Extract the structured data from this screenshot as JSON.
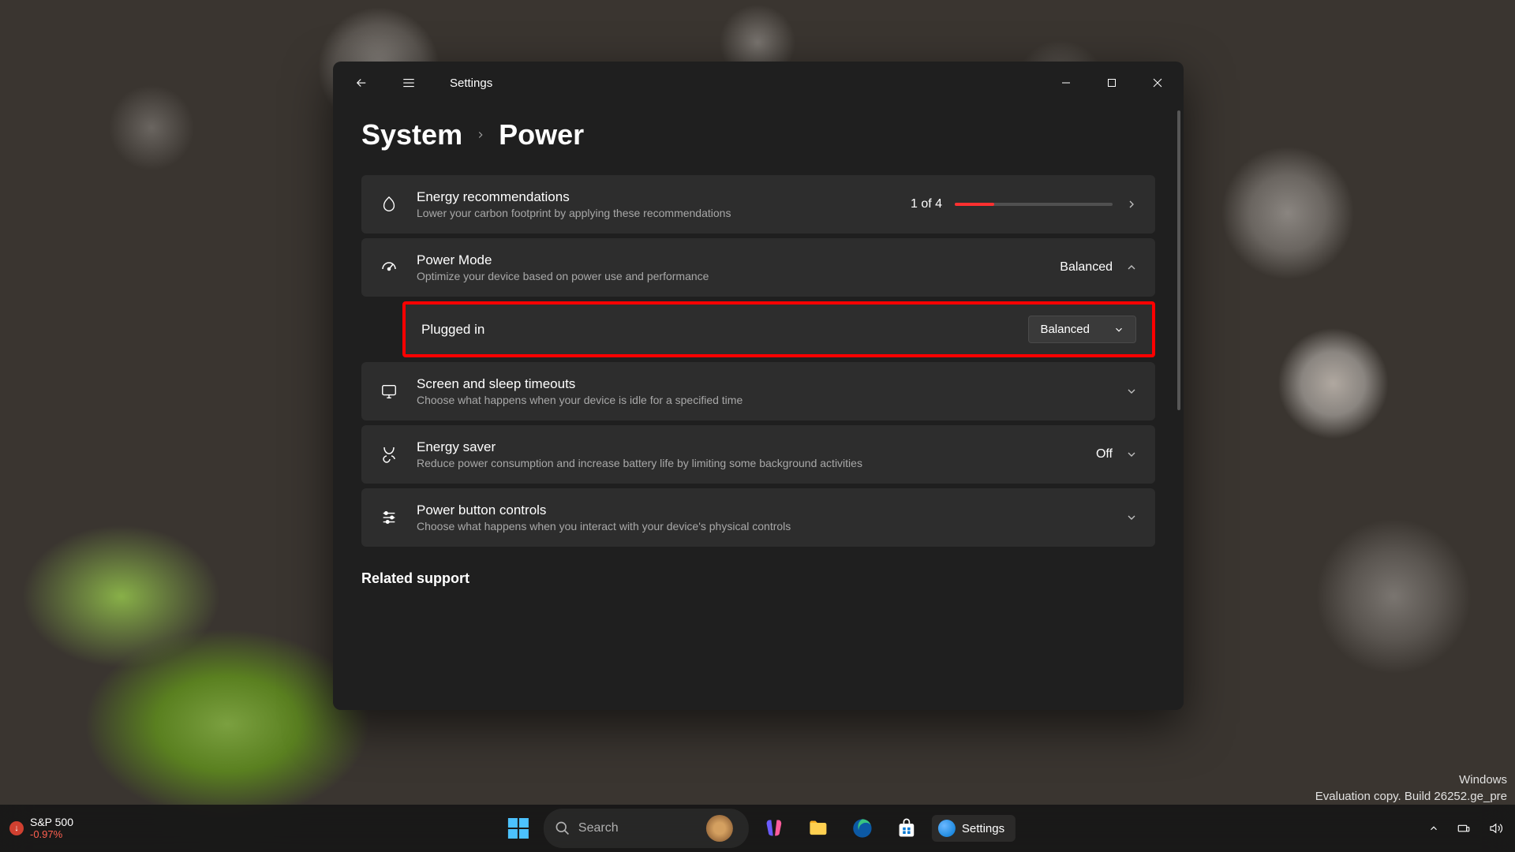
{
  "window": {
    "title": "Settings"
  },
  "breadcrumb": {
    "parent": "System",
    "current": "Power"
  },
  "cards": {
    "energy_rec": {
      "title": "Energy recommendations",
      "sub": "Lower your carbon footprint by applying these recommendations",
      "progress_text": "1 of 4",
      "progress_pct": 25
    },
    "power_mode": {
      "title": "Power Mode",
      "sub": "Optimize your device based on power use and performance",
      "value": "Balanced"
    },
    "plugged_in": {
      "label": "Plugged in",
      "selected": "Balanced"
    },
    "screen_sleep": {
      "title": "Screen and sleep timeouts",
      "sub": "Choose what happens when your device is idle for a specified time"
    },
    "energy_saver": {
      "title": "Energy saver",
      "sub": "Reduce power consumption and increase battery life by limiting some background activities",
      "value": "Off"
    },
    "power_button": {
      "title": "Power button controls",
      "sub": "Choose what happens when you interact with your device's physical controls"
    }
  },
  "section_related": "Related support",
  "watermark": {
    "line1": "Windows",
    "line2": "Evaluation copy. Build 26252.ge_pre"
  },
  "taskbar": {
    "stock_name": "S&P 500",
    "stock_change": "-0.97%",
    "search_placeholder": "Search",
    "running_app": "Settings"
  }
}
